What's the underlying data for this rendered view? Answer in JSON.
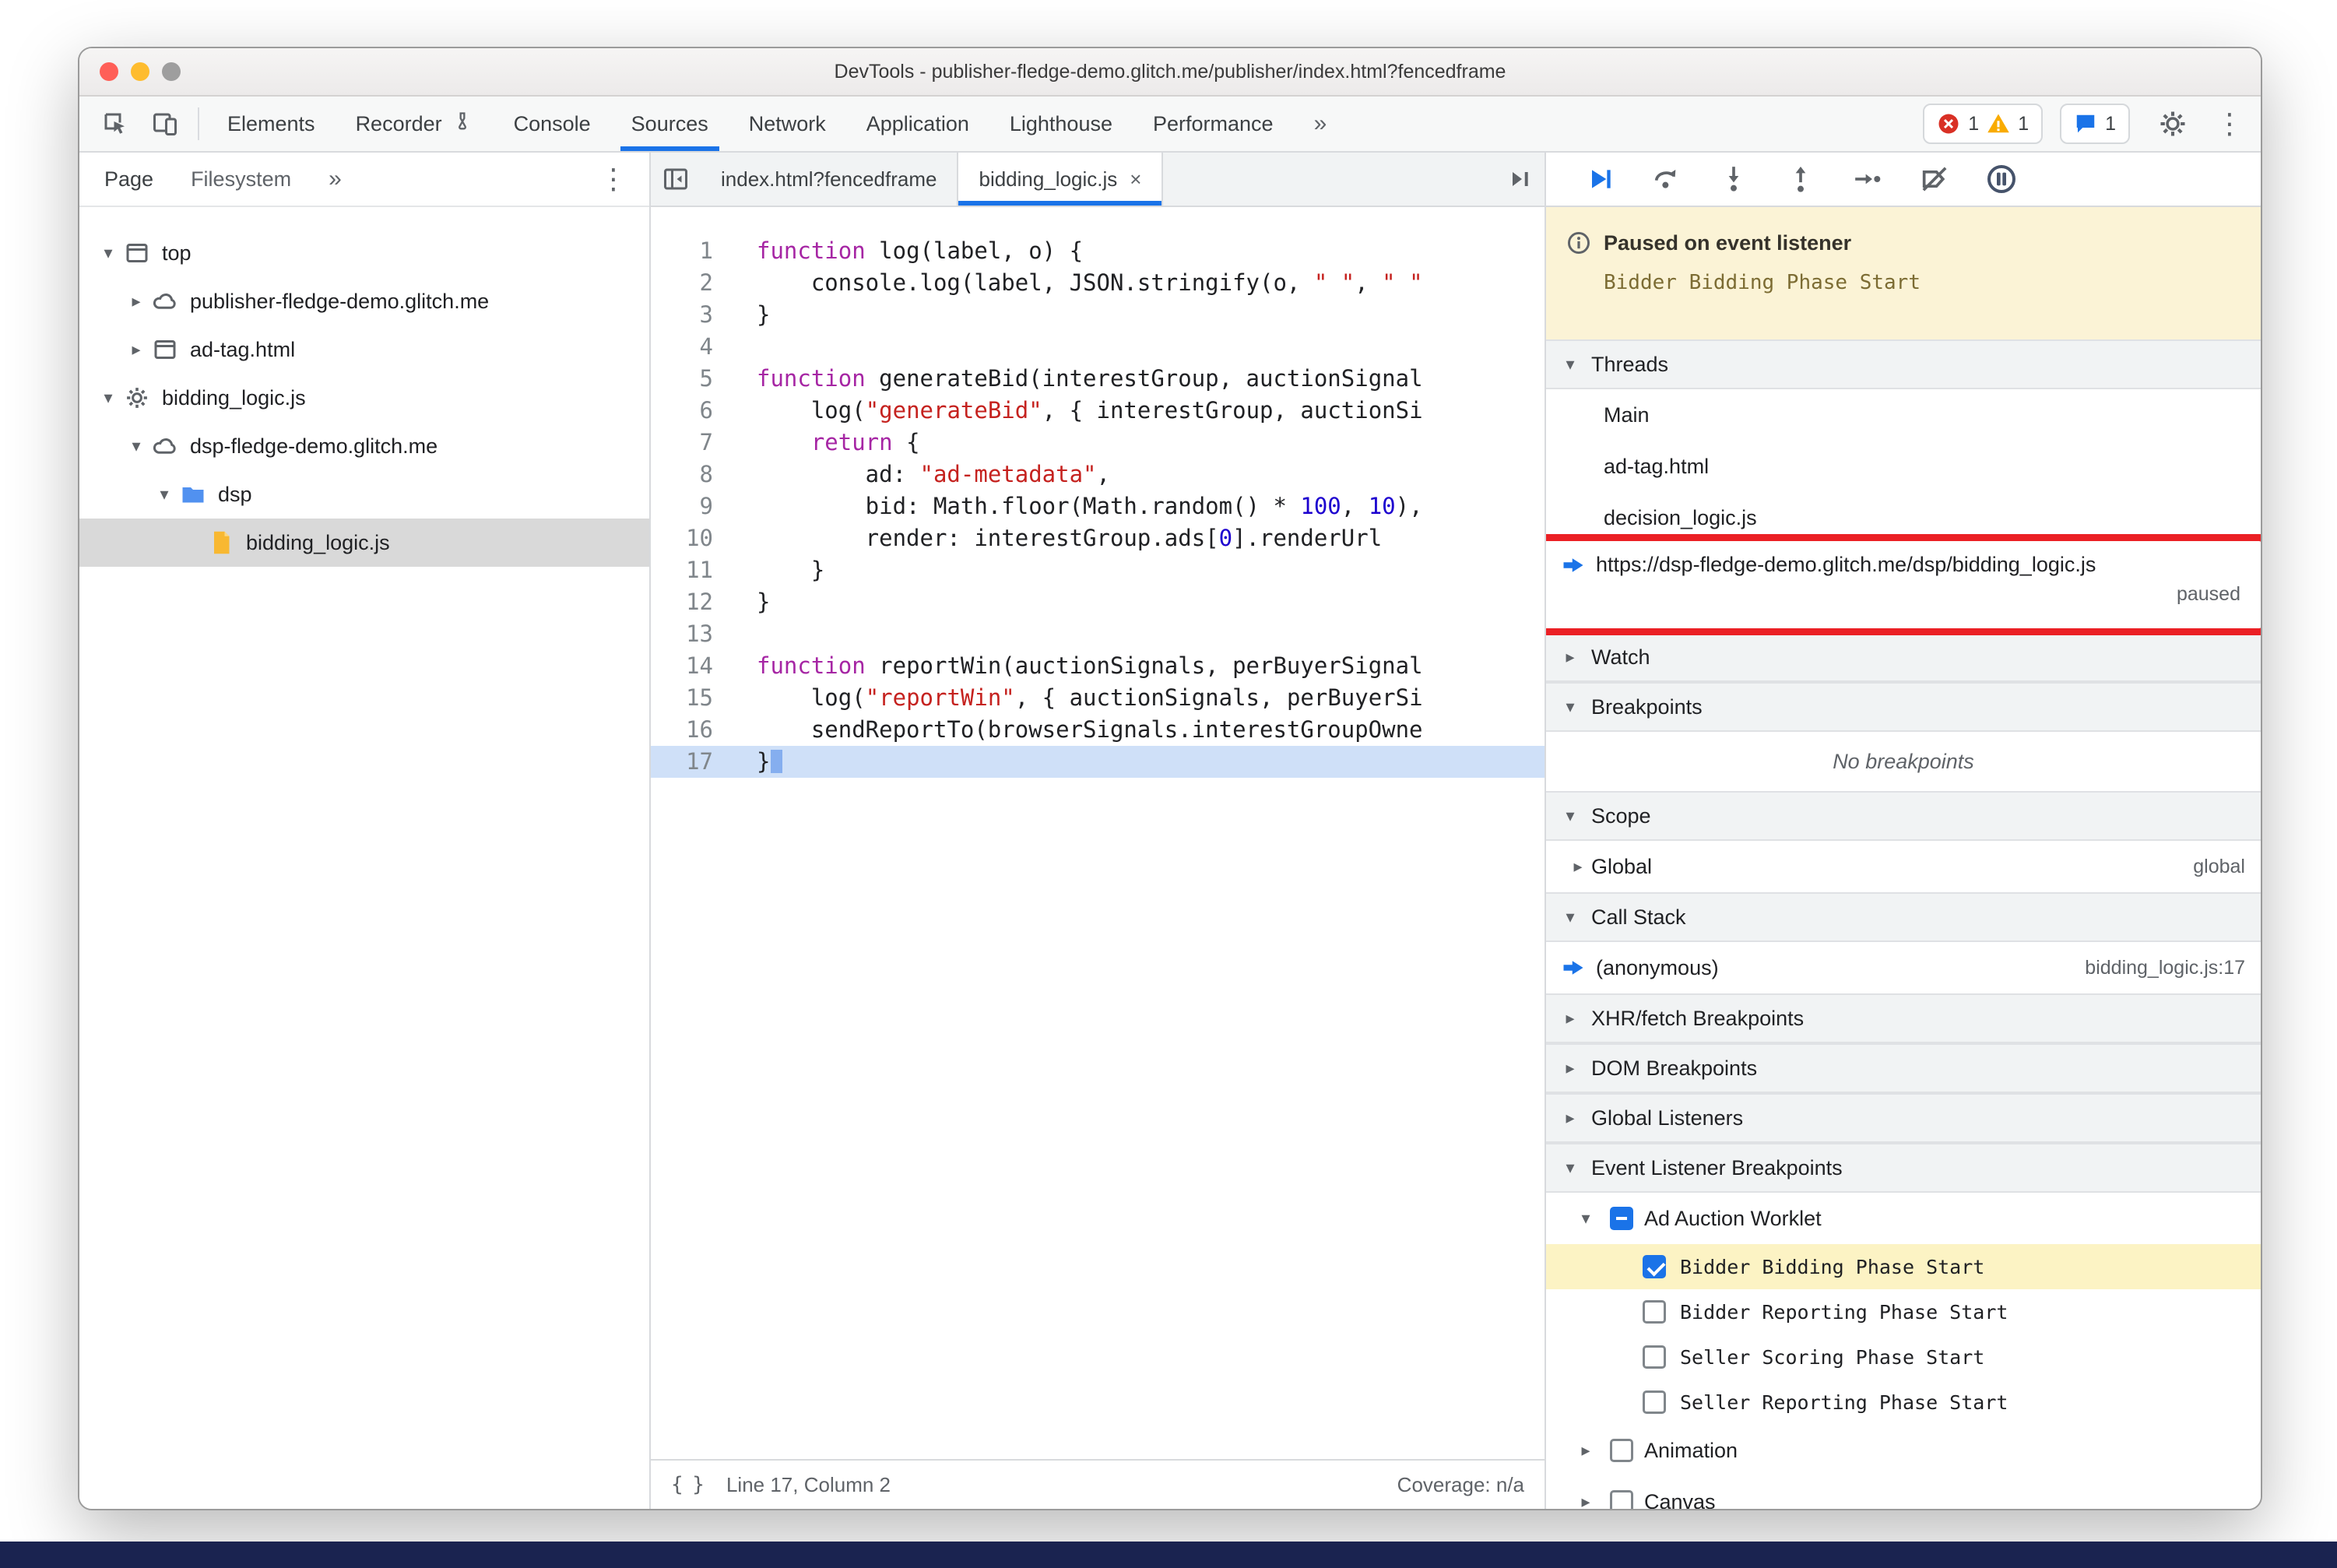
{
  "window": {
    "title": "DevTools - publisher-fledge-demo.glitch.me/publisher/index.html?fencedframe"
  },
  "icons": {
    "more_chevrons": "»",
    "kebab": "⋮",
    "close": "×",
    "expanded_arrow": "▾",
    "collapsed_arrow": "▸"
  },
  "main_toolbar": {
    "tabs": [
      {
        "label": "Elements",
        "selected": false
      },
      {
        "label": "Recorder",
        "selected": false,
        "icon": "flask-icon"
      },
      {
        "label": "Console",
        "selected": false
      },
      {
        "label": "Sources",
        "selected": true
      },
      {
        "label": "Network",
        "selected": false
      },
      {
        "label": "Application",
        "selected": false
      },
      {
        "label": "Lighthouse",
        "selected": false
      },
      {
        "label": "Performance",
        "selected": false
      }
    ],
    "badges": {
      "errors": "1",
      "warnings": "1",
      "issues": "1"
    }
  },
  "sidebar": {
    "tabs": [
      {
        "label": "Page",
        "selected": true
      },
      {
        "label": "Filesystem",
        "selected": false
      }
    ],
    "tree": [
      {
        "label": "top",
        "icon": "frame",
        "arrow": "expanded",
        "level": 0,
        "selected": false
      },
      {
        "label": "publisher-fledge-demo.glitch.me",
        "icon": "cloud",
        "arrow": "collapsed",
        "level": 1,
        "selected": false
      },
      {
        "label": "ad-tag.html",
        "icon": "frame",
        "arrow": "collapsed",
        "level": 1,
        "selected": false
      },
      {
        "label": "bidding_logic.js",
        "icon": "gear",
        "arrow": "expanded",
        "level": 0,
        "selected": false
      },
      {
        "label": "dsp-fledge-demo.glitch.me",
        "icon": "cloud",
        "arrow": "expanded",
        "level": 1,
        "selected": false
      },
      {
        "label": "dsp",
        "icon": "folder",
        "arrow": "expanded",
        "level": 2,
        "selected": false
      },
      {
        "label": "bidding_logic.js",
        "icon": "js-file",
        "arrow": "none",
        "level": 3,
        "selected": true
      }
    ]
  },
  "editor": {
    "tabs": [
      {
        "label": "index.html?fencedframe",
        "active": false,
        "closable": false
      },
      {
        "label": "bidding_logic.js",
        "active": true,
        "closable": true
      }
    ],
    "code": [
      {
        "n": 1,
        "seg": [
          [
            "k",
            "function"
          ],
          [
            "d",
            " log(label, o) {"
          ]
        ]
      },
      {
        "n": 2,
        "seg": [
          [
            "d",
            "    console.log(label, JSON.stringify(o, "
          ],
          [
            "s",
            "\" \""
          ],
          [
            "d",
            ", "
          ],
          [
            "s",
            "\" \""
          ]
        ]
      },
      {
        "n": 3,
        "seg": [
          [
            "d",
            "}"
          ]
        ]
      },
      {
        "n": 4,
        "seg": []
      },
      {
        "n": 5,
        "seg": [
          [
            "k",
            "function"
          ],
          [
            "d",
            " generateBid(interestGroup, auctionSignal"
          ]
        ]
      },
      {
        "n": 6,
        "seg": [
          [
            "d",
            "    log("
          ],
          [
            "s",
            "\"generateBid\""
          ],
          [
            "d",
            ", { interestGroup, auctionSi"
          ]
        ]
      },
      {
        "n": 7,
        "seg": [
          [
            "d",
            "    "
          ],
          [
            "k",
            "return"
          ],
          [
            "d",
            " {"
          ]
        ]
      },
      {
        "n": 8,
        "seg": [
          [
            "d",
            "        ad: "
          ],
          [
            "s",
            "\"ad-metadata\""
          ],
          [
            "d",
            ","
          ]
        ]
      },
      {
        "n": 9,
        "seg": [
          [
            "d",
            "        bid: Math.floor(Math.random() * "
          ],
          [
            "num",
            "100"
          ],
          [
            "d",
            ", "
          ],
          [
            "num",
            "10"
          ],
          [
            "d",
            "),"
          ]
        ]
      },
      {
        "n": 10,
        "seg": [
          [
            "d",
            "        render: interestGroup.ads["
          ],
          [
            "num",
            "0"
          ],
          [
            "d",
            "].renderUrl"
          ]
        ]
      },
      {
        "n": 11,
        "seg": [
          [
            "d",
            "    }"
          ]
        ]
      },
      {
        "n": 12,
        "seg": [
          [
            "d",
            "}"
          ]
        ]
      },
      {
        "n": 13,
        "seg": []
      },
      {
        "n": 14,
        "seg": [
          [
            "k",
            "function"
          ],
          [
            "d",
            " reportWin(auctionSignals, perBuyerSignal"
          ]
        ]
      },
      {
        "n": 15,
        "seg": [
          [
            "d",
            "    log("
          ],
          [
            "s",
            "\"reportWin\""
          ],
          [
            "d",
            ", { auctionSignals, perBuyerSi"
          ]
        ]
      },
      {
        "n": 16,
        "seg": [
          [
            "d",
            "    sendReportTo(browserSignals.interestGroupOwne"
          ]
        ]
      },
      {
        "n": 17,
        "seg": [
          [
            "d",
            "}"
          ]
        ],
        "highlight": true,
        "caret": true
      }
    ],
    "status": {
      "pretty_print": "{ }",
      "position": "Line 17, Column 2",
      "coverage": "Coverage: n/a"
    }
  },
  "debugger": {
    "toolbar_buttons": [
      "resume",
      "step-over",
      "step-into",
      "step-out",
      "step",
      "deactivate-breakpoints",
      "pause-on-exceptions"
    ],
    "paused": {
      "title": "Paused on event listener",
      "detail": "Bidder Bidding Phase Start"
    },
    "threads": {
      "title": "Threads",
      "items": [
        {
          "label": "Main",
          "current": false
        },
        {
          "label": "ad-tag.html",
          "current": false
        },
        {
          "label": "decision_logic.js",
          "current": false
        },
        {
          "label": "https://dsp-fledge-demo.glitch.me/dsp/bidding_logic.js",
          "status": "paused",
          "current": true,
          "annotated": true
        }
      ]
    },
    "watch": {
      "title": "Watch"
    },
    "breakpoints": {
      "title": "Breakpoints",
      "empty_message": "No breakpoints"
    },
    "scope": {
      "title": "Scope",
      "items": [
        {
          "label": "Global",
          "hint": "global"
        }
      ]
    },
    "call_stack": {
      "title": "Call Stack",
      "frames": [
        {
          "name": "(anonymous)",
          "location": "bidding_logic.js:17",
          "current": true
        }
      ]
    },
    "xhr_breakpoints": {
      "title": "XHR/fetch Breakpoints"
    },
    "dom_breakpoints": {
      "title": "DOM Breakpoints"
    },
    "global_listeners": {
      "title": "Global Listeners"
    },
    "event_listener_breakpoints": {
      "title": "Event Listener Breakpoints",
      "categories": [
        {
          "label": "Ad Auction Worklet",
          "checkbox": "indeterminate",
          "expanded": true,
          "children": [
            {
              "label": "Bidder Bidding Phase Start",
              "checkbox": "checked",
              "highlighted": true
            },
            {
              "label": "Bidder Reporting Phase Start",
              "checkbox": "unchecked",
              "highlighted": false
            },
            {
              "label": "Seller Scoring Phase Start",
              "checkbox": "unchecked",
              "highlighted": false
            },
            {
              "label": "Seller Reporting Phase Start",
              "checkbox": "unchecked",
              "highlighted": false
            }
          ]
        },
        {
          "label": "Animation",
          "checkbox": "unchecked",
          "expanded": false,
          "children": []
        },
        {
          "label": "Canvas",
          "checkbox": "unchecked",
          "expanded": false,
          "children": []
        }
      ]
    }
  },
  "colors": {
    "accent": "#1a73e8",
    "error": "#d93025",
    "warning": "#f9ab00",
    "paused_banner_bg": "#fbf3d6",
    "annotation_red": "#eb2025",
    "selected_row": "#d9d9d9",
    "highlight_yellow": "#fcf3c4",
    "exec_line": "#cfe0f8"
  }
}
